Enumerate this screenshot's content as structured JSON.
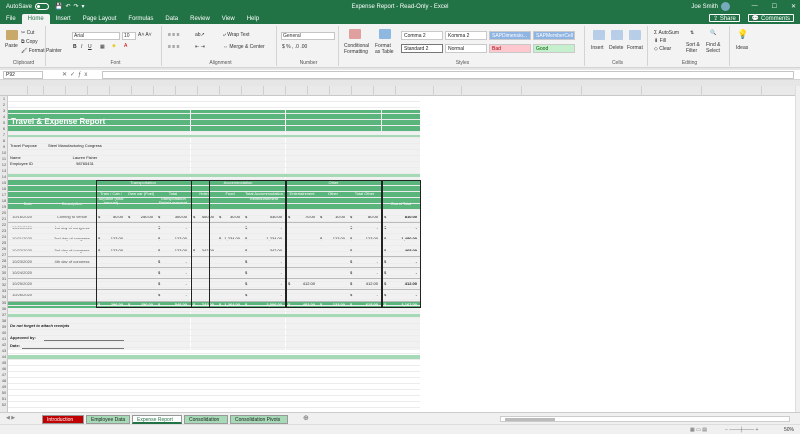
{
  "titlebar": {
    "autosave": "AutoSave",
    "autosave_state": "Off",
    "doc_title": "Expense Report - Read-Only - Excel",
    "user": "Joe Smith"
  },
  "menu": {
    "tabs": [
      "File",
      "Home",
      "Insert",
      "Page Layout",
      "Formulas",
      "Data",
      "Review",
      "View",
      "Help"
    ],
    "active": "Home",
    "share": "Share",
    "comments": "Comments"
  },
  "ribbon": {
    "clipboard": {
      "paste": "Paste",
      "cut": "Cut",
      "copy": "Copy",
      "format_painter": "Format Painter",
      "label": "Clipboard"
    },
    "font": {
      "name": "Arial",
      "size": "10",
      "label": "Font"
    },
    "alignment": {
      "wrap": "Wrap Text",
      "merge": "Merge & Center",
      "label": "Alignment"
    },
    "number": {
      "format": "General",
      "label": "Number"
    },
    "styles": {
      "cond": "Conditional Formatting",
      "table": "Format as Table",
      "label": "Styles",
      "cells": [
        "Comma 2",
        "Komma 2",
        "SAPDimensio...",
        "SAPMemberCell",
        "Standard 2",
        "Normal",
        "Bad",
        "Good"
      ]
    },
    "cells": {
      "insert": "Insert",
      "delete": "Delete",
      "format": "Format",
      "label": "Cells"
    },
    "editing": {
      "autosum": "AutoSum",
      "fill": "Fill",
      "clear": "Clear",
      "sort": "Sort & Filter",
      "find": "Find & Select",
      "label": "Editing"
    },
    "ideas": {
      "label": "Ideas"
    }
  },
  "formula": {
    "namebox": "P92"
  },
  "report": {
    "title": "Travel & Expense Report",
    "purpose_label": "Travel Purpose",
    "purpose_value": "Steel Manufacturing Congress",
    "name_label": "Name",
    "name_value": "Lauren Fisher",
    "emp_label": "Employee ID",
    "emp_value": "98765431",
    "groups": {
      "transport": "Transportation",
      "accom": "Accommodation",
      "other": "Other"
    },
    "headers": [
      "Date",
      "Description",
      "Train / Cab / Airplane (total amount)",
      "Own car (Fuel)",
      "Total Transportation Reimbursement",
      "Hotel",
      "Food",
      "Total Accommodation Reimbursement",
      "Entertainment",
      "Other",
      "Total Other",
      "Grand Total"
    ],
    "rows": [
      [
        "10/16/2020",
        "Coming to venue",
        "$",
        "50.00",
        "$",
        "250.00",
        "$",
        "300.00",
        "$",
        "400.00",
        "$",
        "30.00",
        "$",
        "430.00",
        "$",
        "70.00",
        "$",
        "10.00",
        "$",
        "80.00",
        "$",
        "810.00"
      ],
      [
        "10/20/2020",
        "1st day of congress",
        "",
        "",
        "",
        "",
        "$",
        "-",
        "",
        "",
        "",
        "",
        "$",
        "-",
        "",
        "",
        "",
        "",
        "$",
        "-",
        "$",
        "-"
      ],
      [
        "10/21/2020",
        "2nd day of congress",
        "$",
        "123.00",
        "",
        "",
        "$",
        "123.00",
        "",
        "",
        "$",
        "1,234.00",
        "$",
        "1,234.00",
        "",
        "",
        "$",
        "123.00",
        "$",
        "123.00",
        "$",
        "1,480.00"
      ],
      [
        "10/22/2020",
        "3rd day of congress",
        "$",
        "123.00",
        "",
        "",
        "$",
        "123.00",
        "$",
        "342.00",
        "",
        "",
        "$",
        "342.00",
        "",
        "",
        "",
        "",
        "$",
        "-",
        "$",
        "465.00"
      ],
      [
        "10/23/2020",
        "4th day of congress",
        "",
        "",
        "",
        "",
        "$",
        "-",
        "",
        "",
        "",
        "",
        "$",
        "-",
        "",
        "",
        "",
        "",
        "$",
        "-",
        "$",
        "-"
      ],
      [
        "10/24/2020",
        "",
        "",
        "",
        "",
        "",
        "$",
        "-",
        "",
        "",
        "",
        "",
        "$",
        "-",
        "",
        "",
        "",
        "",
        "$",
        "-",
        "$",
        "-"
      ],
      [
        "10/25/2020",
        "",
        "",
        "",
        "",
        "",
        "$",
        "-",
        "",
        "",
        "",
        "",
        "$",
        "-",
        "$",
        "412.00",
        "",
        "",
        "$",
        "412.00",
        "$",
        "412.00"
      ],
      [
        "10/26/2020",
        "",
        "",
        "",
        "",
        "",
        "$",
        "-",
        "",
        "",
        "",
        "",
        "$",
        "-",
        "",
        "",
        "",
        "",
        "$",
        "-",
        "$",
        "-"
      ]
    ],
    "totals": [
      "$",
      "296.00",
      "$",
      "250.00",
      "$",
      "546.00",
      "$",
      "742.00",
      "$",
      "1,264.00",
      "$",
      "2,006.00",
      "$",
      "482.00",
      "$",
      "133.00",
      "$",
      "615.00",
      "$",
      "3,167.00"
    ],
    "reminder": "Do not forget to attach receipts",
    "approved": "Approved by:",
    "date": "Date:"
  },
  "sheets": {
    "tabs": [
      "Introduction",
      "Employee Data",
      "Expense Report",
      "Consolidation",
      "Consolidation Pivots"
    ],
    "active": "Expense Report"
  },
  "status": {
    "zoom": "50%"
  },
  "colors": {
    "excel_green": "#217346",
    "table_green": "#5ab57c",
    "light_green": "#a6d9b5",
    "intro_red": "#c00000"
  }
}
